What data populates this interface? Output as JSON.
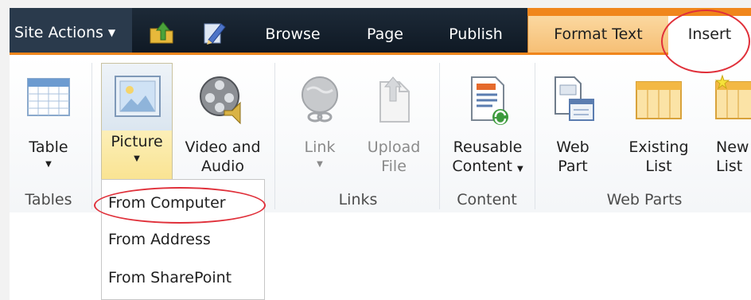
{
  "tabs": {
    "site_actions": "Site Actions",
    "browse": "Browse",
    "page": "Page",
    "publish": "Publish",
    "format_text": "Format Text",
    "insert": "Insert"
  },
  "ribbon": {
    "groups": {
      "tables": "Tables",
      "links": "Links",
      "content": "Content",
      "web_parts": "Web Parts"
    },
    "buttons": {
      "table": "Table",
      "picture": "Picture",
      "video_line1": "Video and",
      "video_line2": "Audio",
      "link": "Link",
      "upload_line1": "Upload",
      "upload_line2": "File",
      "reusable_line1": "Reusable",
      "reusable_line2": "Content",
      "webpart_line1": "Web",
      "webpart_line2": "Part",
      "existing_line1": "Existing",
      "existing_line2": "List",
      "new_line1": "New",
      "new_line2": "List"
    }
  },
  "picture_menu": {
    "items": [
      "From Computer",
      "From Address",
      "From SharePoint"
    ]
  },
  "colors": {
    "tabbar": "#1d2a38",
    "contextual_accent": "#f0861c",
    "highlight_circle": "#e0303a"
  }
}
